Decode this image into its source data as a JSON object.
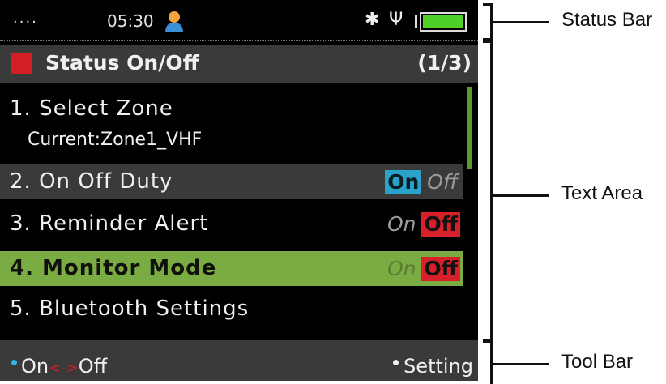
{
  "status_bar": {
    "signal_dots": "....",
    "time": "05:30",
    "bluetooth_icon": "bluetooth-icon",
    "usb_icon": "usb-icon",
    "battery_icon": "battery-icon"
  },
  "title_bar": {
    "title": "Status On/Off",
    "page": "(1/3)"
  },
  "menu": {
    "items": [
      {
        "label": "1. Select Zone",
        "sub": "Current:Zone1_VHF"
      },
      {
        "label": "2. On Off Duty",
        "on": "On",
        "off": "Off",
        "state": "on"
      },
      {
        "label": "3. Reminder Alert",
        "on": "On",
        "off": "Off",
        "state": "off"
      },
      {
        "label": "4. Monitor Mode",
        "on": "On",
        "off": "Off",
        "state": "off",
        "selected": true
      },
      {
        "label": "5. Bluetooth Settings"
      }
    ]
  },
  "tool_bar": {
    "left_on": "On",
    "left_arrow": "<->",
    "left_off": "Off",
    "right": "Setting"
  },
  "annotations": {
    "status_bar": "Status Bar",
    "text_area": "Text Area",
    "tool_bar": "Tool Bar"
  },
  "colors": {
    "selected_row": "#7aac43",
    "on_active": "#29a3c9",
    "off_active": "#d8202a",
    "title_icon": "#d21f26"
  }
}
